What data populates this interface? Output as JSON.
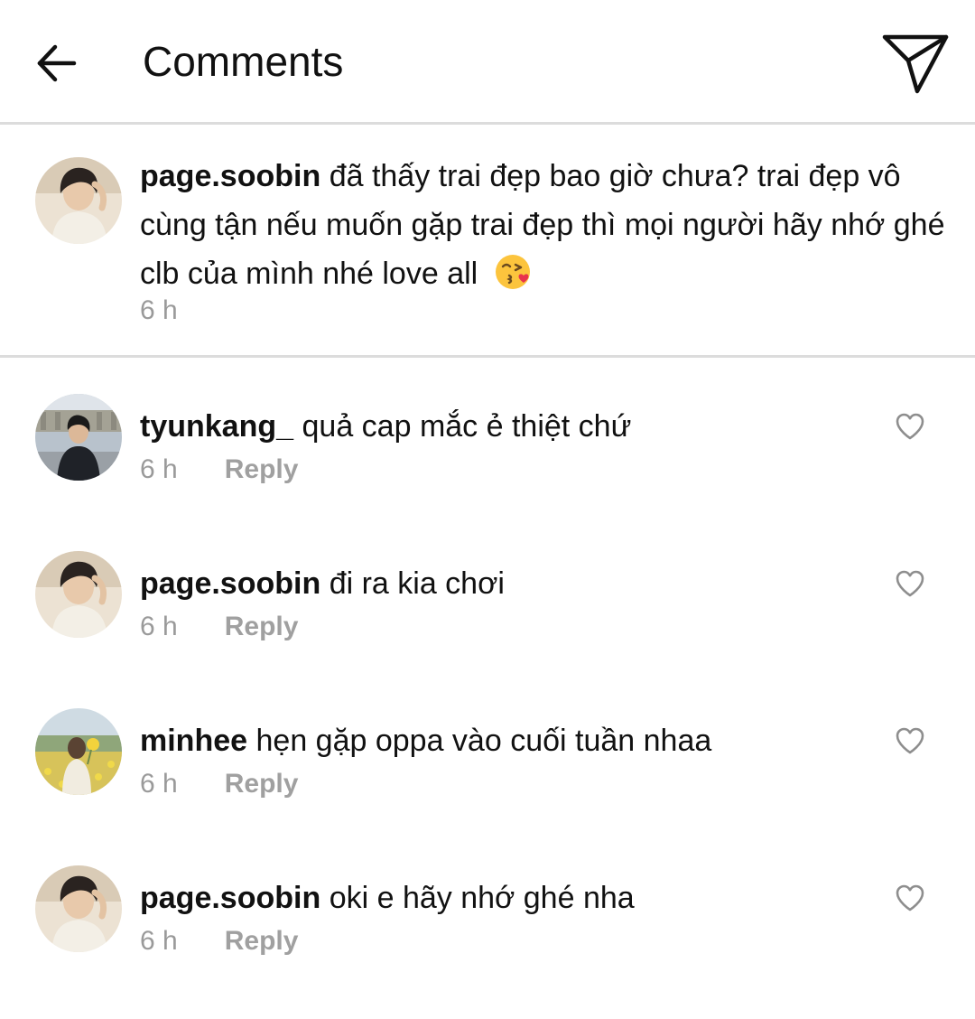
{
  "header": {
    "title": "Comments",
    "back_icon": "arrow-left-icon",
    "send_icon": "paper-plane-icon"
  },
  "caption": {
    "username": "page.soobin",
    "text": "đã thấy trai đẹp bao giờ chưa? trai đẹp vô cùng tận nếu muốn gặp trai đẹp thì mọi người hãy nhớ ghé clb của mình nhé love all",
    "emoji": "face-blowing-kiss-emoji",
    "time": "6 h"
  },
  "comments": [
    {
      "username": "tyunkang_",
      "text": "quả cap mắc ẻ thiệt chứ",
      "time": "6 h",
      "reply_label": "Reply"
    },
    {
      "username": "page.soobin",
      "text": "đi ra kia chơi",
      "time": "6 h",
      "reply_label": "Reply"
    },
    {
      "username": "minhee",
      "text": "hẹn gặp oppa vào cuối tuần nhaa",
      "time": "6 h",
      "reply_label": "Reply"
    },
    {
      "username": "page.soobin",
      "text": "oki e hãy nhớ ghé nha",
      "time": "6 h",
      "reply_label": "Reply"
    }
  ],
  "colors": {
    "text": "#111111",
    "muted": "#9a9a9a",
    "divider": "#dcdcdc",
    "heart_outline": "#8e8e8e"
  }
}
